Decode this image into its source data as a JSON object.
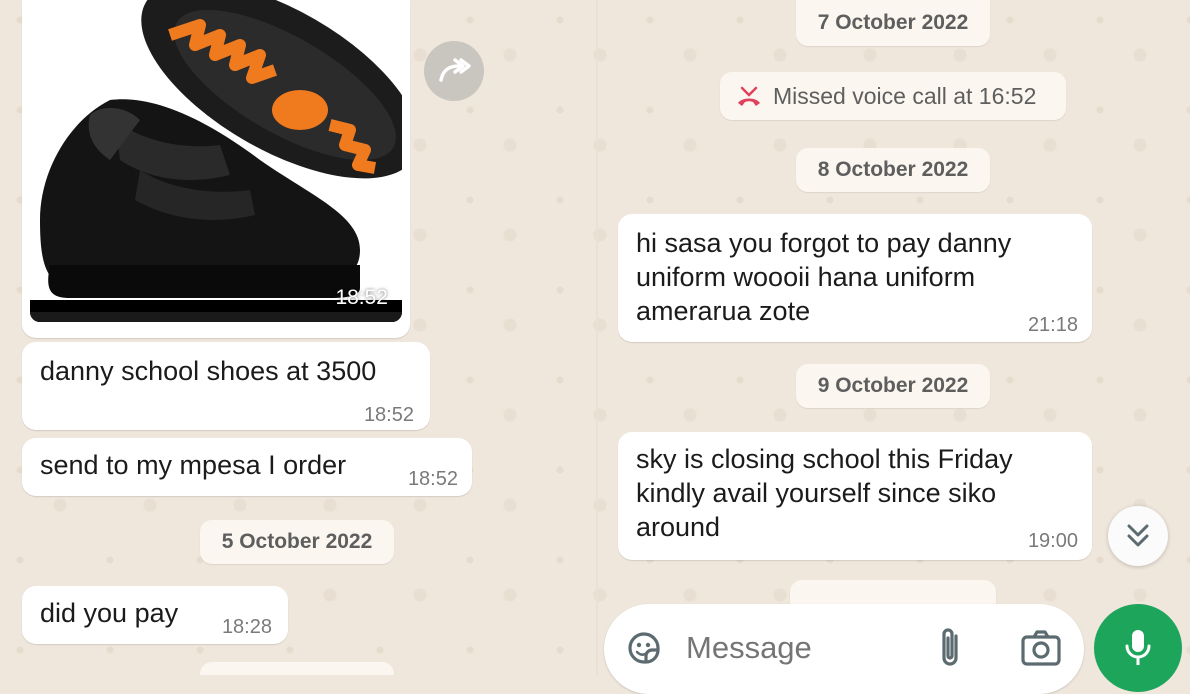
{
  "left_pane": {
    "image_message": {
      "time": "18:52",
      "description_icon": "school-shoes-photo"
    },
    "messages": [
      {
        "text": "danny school shoes at 3500",
        "time": "18:52"
      },
      {
        "text": "send to my mpesa I order",
        "time": "18:52"
      }
    ],
    "date_chip": "5 October 2022",
    "messages_after": [
      {
        "text": "did you pay",
        "time": "18:28"
      }
    ]
  },
  "right_pane": {
    "date_chips": [
      "7 October 2022",
      "8 October 2022",
      "9 October 2022"
    ],
    "missed_call": "Missed voice call at 16:52",
    "messages": [
      {
        "lines": [
          "hi sasa you forgot to pay danny",
          "uniform woooii hana uniform",
          "amerarua zote"
        ],
        "time": "21:18"
      },
      {
        "lines": [
          "sky  is closing school this Friday",
          "kindly avail yourself since siko",
          "around"
        ],
        "time": "19:00"
      }
    ]
  },
  "composer": {
    "placeholder": "Message"
  },
  "icons": {
    "forward": "forward-icon",
    "missed_call": "missed-call-icon",
    "scroll": "chevron-double-down-icon",
    "emoji": "sticker-icon",
    "attach": "paperclip-icon",
    "camera": "camera-icon",
    "mic": "mic-icon"
  },
  "colors": {
    "background": "#efe7dc",
    "bubble": "#ffffff",
    "accent": "#1ea55c",
    "missed_call_red": "#e0415b"
  }
}
